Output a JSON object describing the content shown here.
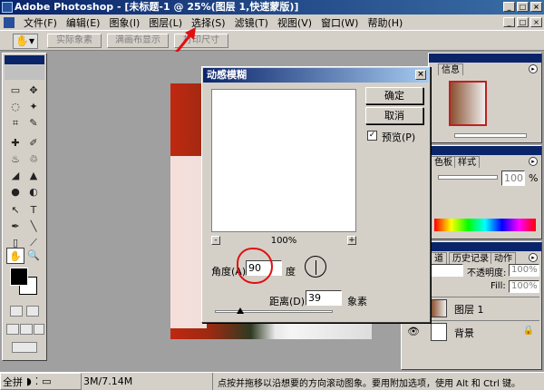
{
  "app": {
    "title": "Adobe Photoshop - [未标题-1 @ 25%(图层 1,快速蒙版)]",
    "window_buttons": [
      "_",
      "□",
      "×"
    ],
    "doc_window_buttons": [
      "_",
      "□",
      "×"
    ]
  },
  "menu": {
    "items": [
      "文件(F)",
      "编辑(E)",
      "图象(I)",
      "图层(L)",
      "选择(S)",
      "滤镜(T)",
      "视图(V)",
      "窗口(W)",
      "帮助(H)"
    ]
  },
  "options_bar": {
    "buttons": [
      "实际象素",
      "满画布显示",
      "打印尺寸"
    ]
  },
  "toolbox": {
    "tools": [
      "▭",
      "✥",
      "◌",
      "✦",
      "⌗",
      "✎",
      "✚",
      "✐",
      "♨",
      "♲",
      "◢",
      "▲",
      "●",
      "◐",
      "↖",
      "T",
      "✒",
      "╲",
      "▯",
      "⟋",
      "✋",
      "🔍"
    ]
  },
  "dialog": {
    "title": "动感模糊",
    "ok_label": "确定",
    "cancel_label": "取消",
    "preview_label": "预览(P)",
    "preview_checked": "✓",
    "zoom_minus": "-",
    "zoom_plus": "+",
    "zoom_value": "100%",
    "angle_label": "角度(A):",
    "angle_value": "90",
    "angle_unit": "度",
    "distance_label": "距离(D):",
    "distance_value": "39",
    "distance_unit": "象素",
    "close_label": "×"
  },
  "panels": {
    "navigator": {
      "tab": "信息"
    },
    "color": {
      "tabs": [
        "色板",
        "样式"
      ],
      "value": "100",
      "unit": "%"
    },
    "layers": {
      "tabs": [
        "道",
        "历史记录",
        "动作"
      ],
      "opacity_label": "不透明度:",
      "opacity_value": "100%",
      "fill_label": "Fill:",
      "fill_value": "100%",
      "rows": [
        {
          "name": "图层 1"
        },
        {
          "name": "背景"
        }
      ]
    }
  },
  "status": {
    "left_icons": [
      "全拼",
      "◗",
      "⁚",
      "▭"
    ],
    "doc_size": "3M/7.14M",
    "hint": "点按并拖移以沿想要的方向滚动图象。要用附加选项，使用 Alt 和 Ctrl 键。"
  },
  "colors": {
    "annotation": "#e01010",
    "titlebar": "#0a246a",
    "chrome": "#d4d0c8"
  }
}
